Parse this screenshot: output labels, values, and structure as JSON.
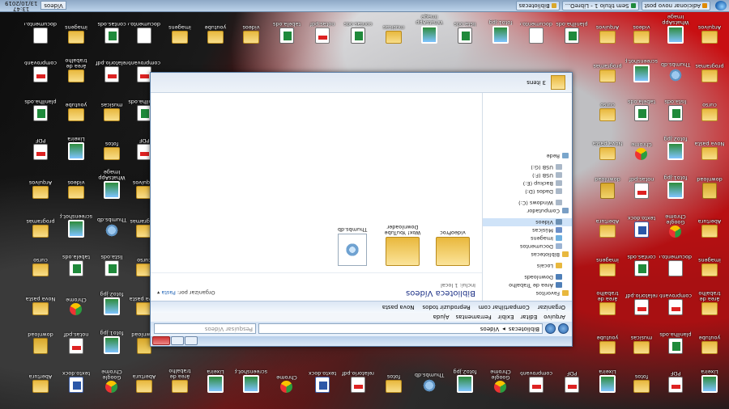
{
  "taskbar": {
    "clock_time": "13:47",
    "clock_date": "13/10/2019",
    "search_placeholder": "Vídeos",
    "buttons": [
      {
        "label": "Adicionar novo post",
        "color": "#e08a00"
      },
      {
        "label": "Sem título 1 - LibreO...",
        "color": "#1f8a3b"
      },
      {
        "label": "Bibliotecas",
        "color": "#d9a82b"
      }
    ]
  },
  "explorer": {
    "address": {
      "crumbs": [
        "Bibliotecas",
        "Vídeos"
      ],
      "search_placeholder": "Pesquisar Vídeos"
    },
    "menu": [
      "Arquivo",
      "Editar",
      "Exibir",
      "Ferramentas",
      "Ajuda"
    ],
    "commands": [
      "Organizar",
      "Compartilhar com",
      "Reproduzir todos",
      "Nova pasta"
    ],
    "nav": [
      {
        "label": "Favoritos",
        "color": "#e8b83e",
        "sel": false
      },
      {
        "label": "Área de Trabalho",
        "color": "#4f7fb8",
        "sel": false
      },
      {
        "label": "Downloads",
        "color": "#4f7fb8",
        "sel": false
      },
      {
        "label": "Locais",
        "color": "#e8b83e",
        "sel": false
      },
      {
        "label": "Bibliotecas",
        "color": "#e8b83e",
        "sel": false
      },
      {
        "label": "Documentos",
        "color": "#9cb4d3",
        "sel": false
      },
      {
        "label": "Imagens",
        "color": "#6fb0e0",
        "sel": false
      },
      {
        "label": "Músicas",
        "color": "#6b8fc8",
        "sel": false
      },
      {
        "label": "Vídeos",
        "color": "#6a8fb3",
        "sel": true
      },
      {
        "label": "Computador",
        "color": "#7a9fc5",
        "sel": false
      },
      {
        "label": "Windows (C:)",
        "color": "#aab8c8",
        "sel": false
      },
      {
        "label": "Dados (D:)",
        "color": "#aab8c8",
        "sel": false
      },
      {
        "label": "Backup (E:)",
        "color": "#aab8c8",
        "sel": false
      },
      {
        "label": "USB (F:)",
        "color": "#aab8c8",
        "sel": false
      },
      {
        "label": "USB (G:)",
        "color": "#aab8c8",
        "sel": false
      },
      {
        "label": "Rede",
        "color": "#7aa6cc",
        "sel": false
      }
    ],
    "library": {
      "title": "Biblioteca Vídeos",
      "subtitle": "Inclui: 1 local",
      "arrange_label": "Organizar por:",
      "arrange_value": "Pasta"
    },
    "items": [
      {
        "label": "videoProc",
        "type": "folder"
      },
      {
        "label": "Wox! YouTube Downloader",
        "type": "folder"
      },
      {
        "label": "Thumbs.db",
        "type": "file"
      }
    ],
    "details": "3 itens"
  },
  "desktop": {
    "icons": [
      {
        "label": "Lixeira",
        "type": "img"
      },
      {
        "label": "youtube",
        "type": "folder"
      },
      {
        "label": "área de trabalho",
        "type": "folder"
      },
      {
        "label": "imagens",
        "type": "folder"
      },
      {
        "label": "Abertura",
        "type": "folder"
      },
      {
        "label": "download",
        "type": "zip"
      },
      {
        "label": "Nova pasta",
        "type": "folder"
      },
      {
        "label": "curso",
        "type": "folder"
      },
      {
        "label": "programas",
        "type": "folder"
      },
      {
        "label": "Arquivos",
        "type": "folder"
      },
      {
        "label": "PDF",
        "type": "pdf"
      },
      {
        "label": "planilha.ods",
        "type": "excel"
      },
      {
        "label": "comprovante.pdf",
        "type": "pdf"
      },
      {
        "label": "documento.doc",
        "type": "doc"
      },
      {
        "label": "Google Chrome",
        "type": "chrome"
      },
      {
        "label": "foto1.jpg",
        "type": "img"
      },
      {
        "label": "foto2.jpg",
        "type": "img"
      },
      {
        "label": "lista.ods",
        "type": "excel"
      },
      {
        "label": "Thumbs.db",
        "type": "gear"
      },
      {
        "label": "WhatsApp Image",
        "type": "img"
      },
      {
        "label": "fotos",
        "type": "folder"
      },
      {
        "label": "musicas",
        "type": "folder"
      },
      {
        "label": "relatorio.pdf",
        "type": "pdf"
      },
      {
        "label": "contas.ods",
        "type": "excel"
      },
      {
        "label": "texto.docx",
        "type": "docx"
      },
      {
        "label": "notas.pdf",
        "type": "pdf"
      },
      {
        "label": "Chrome",
        "type": "chrome"
      },
      {
        "label": "tabela.ods",
        "type": "excel"
      },
      {
        "label": "screenshot.png",
        "type": "img"
      },
      {
        "label": "videos",
        "type": "folder"
      }
    ]
  }
}
